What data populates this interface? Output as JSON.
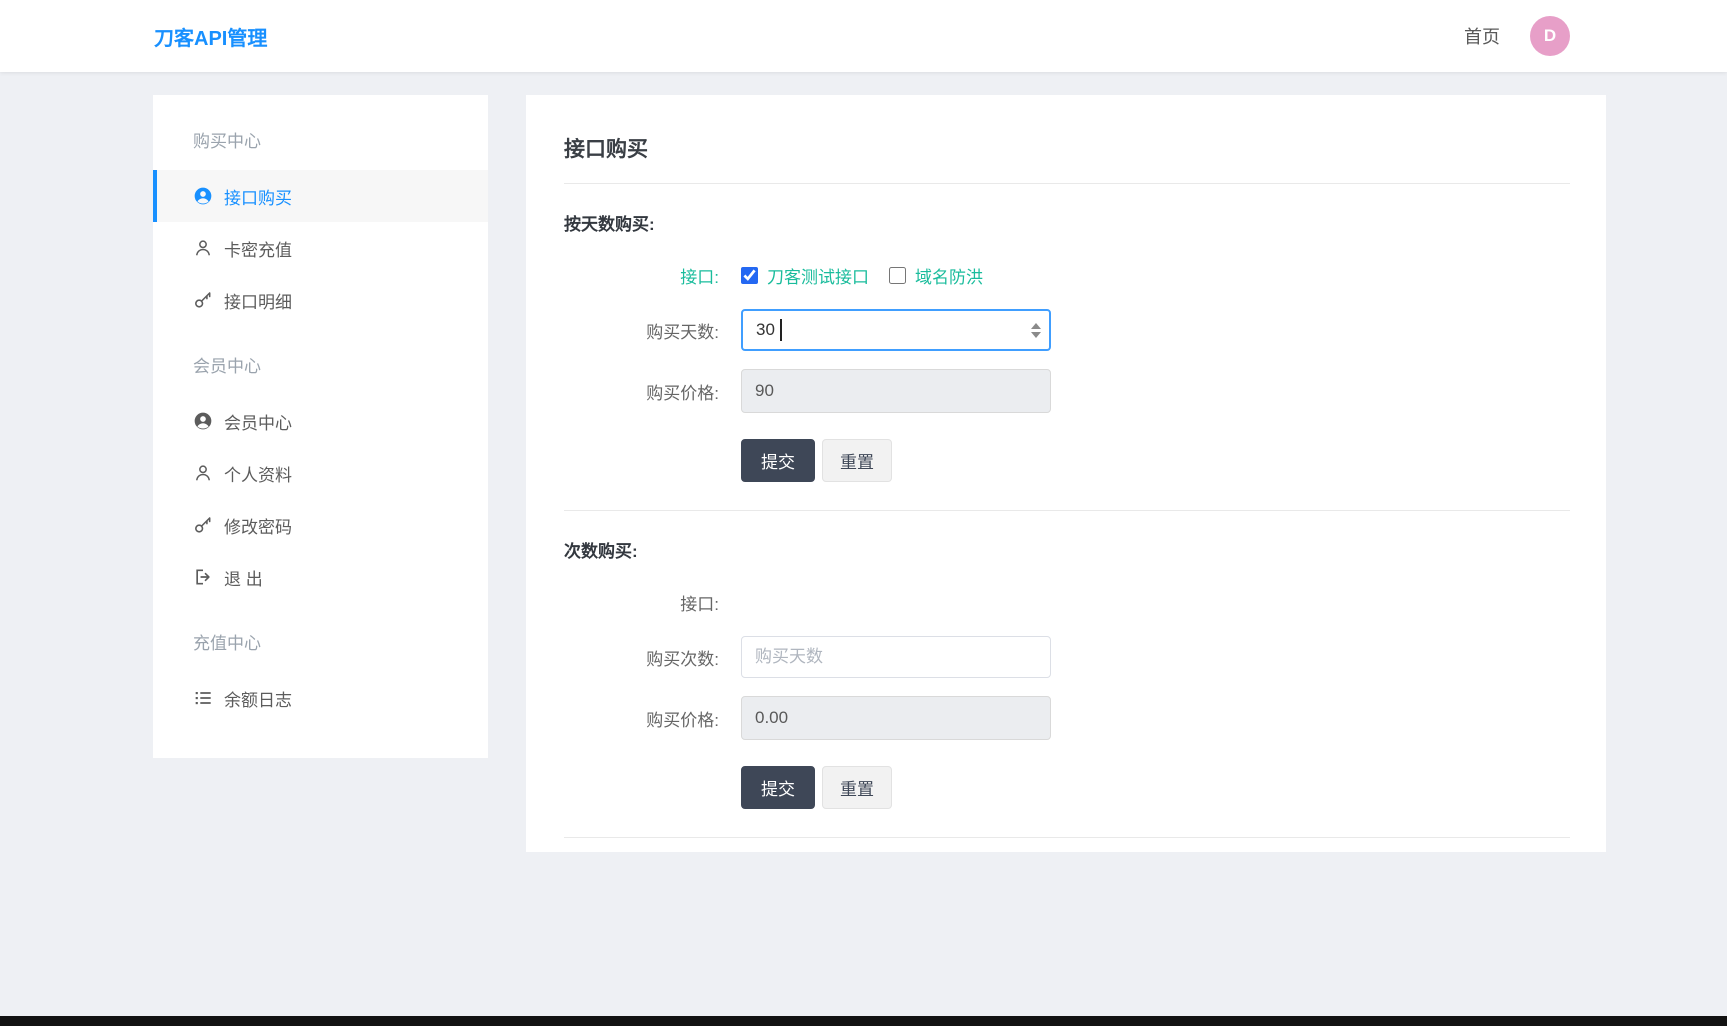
{
  "header": {
    "brand": "刀客API管理",
    "nav_home": "首页",
    "avatar_letter": "D"
  },
  "sidebar": {
    "sections": [
      {
        "heading": "购买中心",
        "items": [
          {
            "label": "接口购买",
            "icon": "user-circle-icon",
            "active": true
          },
          {
            "label": "卡密充值",
            "icon": "user-icon",
            "active": false
          },
          {
            "label": "接口明细",
            "icon": "key-icon",
            "active": false
          }
        ]
      },
      {
        "heading": "会员中心",
        "items": [
          {
            "label": "会员中心",
            "icon": "user-circle-icon",
            "active": false
          },
          {
            "label": "个人资料",
            "icon": "user-icon",
            "active": false
          },
          {
            "label": "修改密码",
            "icon": "key-icon",
            "active": false
          },
          {
            "label": "退 出",
            "icon": "sign-out-icon",
            "active": false
          }
        ]
      },
      {
        "heading": "充值中心",
        "items": [
          {
            "label": "余额日志",
            "icon": "list-icon",
            "active": false
          }
        ]
      }
    ]
  },
  "main": {
    "title": "接口购买",
    "day_form": {
      "heading": "按天数购买:",
      "api_label": "接口:",
      "checkboxes": [
        {
          "label": "刀客测试接口",
          "checked": "checked"
        },
        {
          "label": "域名防洪"
        }
      ],
      "days_label": "购买天数:",
      "days_value": "30",
      "price_label": "购买价格:",
      "price_value": "90",
      "submit_label": "提交",
      "reset_label": "重置"
    },
    "count_form": {
      "heading": "次数购买:",
      "api_label": "接口:",
      "count_label": "购买次数:",
      "count_placeholder": "购买天数",
      "price_label": "购买价格:",
      "price_value": "0.00",
      "submit_label": "提交",
      "reset_label": "重置"
    }
  },
  "colors": {
    "accent_blue": "#1890ff",
    "label_green": "#1abc9c",
    "avatar_pink": "#e79fc8",
    "button_dark": "#3e4757",
    "focus_border": "#409eff",
    "page_background": "#eef0f4"
  }
}
